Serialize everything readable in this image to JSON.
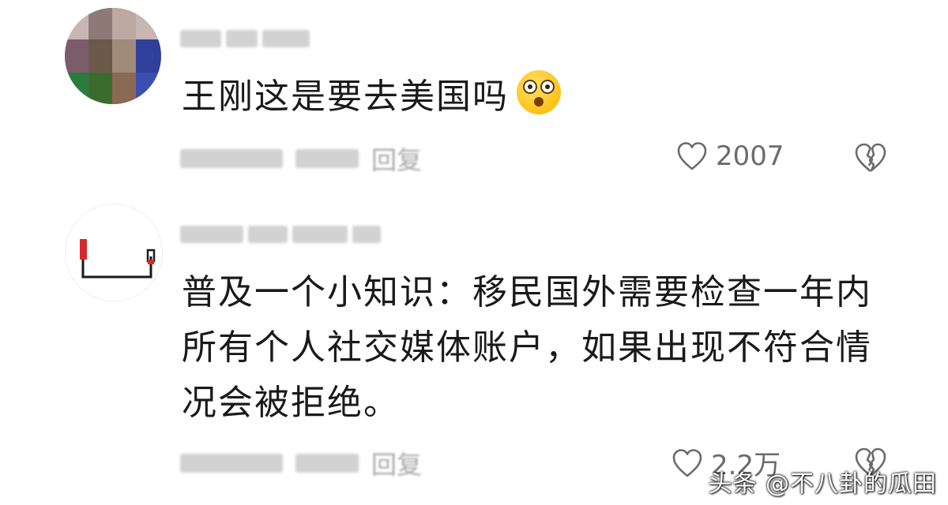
{
  "comments": [
    {
      "text": "王刚这是要去美国吗",
      "emoji_icon": "astonished-face-emoji",
      "reply_label": "回复",
      "like_count": "2007"
    },
    {
      "text": "普及一个小知识：移民国外需要检查一年内所有个人社交媒体账户，如果出现不符合情况会被拒绝。",
      "reply_label": "回复",
      "like_count": "2.2万"
    }
  ],
  "watermark": "头条 @不八卦的瓜田",
  "colors": {
    "text": "#1a1a1a",
    "meta": "#6b6b6b",
    "accent_red": "#d62b2b"
  }
}
